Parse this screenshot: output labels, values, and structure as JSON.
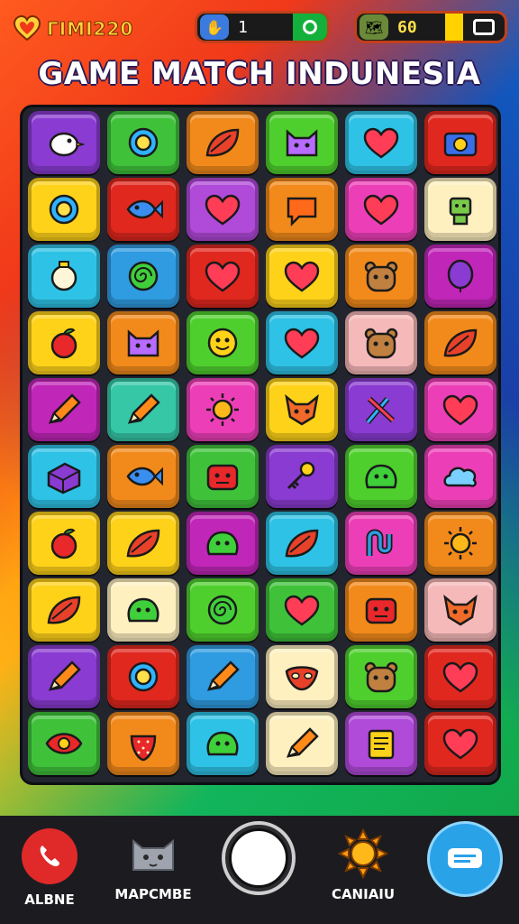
{
  "header": {
    "brand_text": "ΓΙΜΙ220",
    "brand_icon": "heart-icon",
    "left_counter": "1",
    "right_counter": "60",
    "title": "GAME MATCH INDUNESIA"
  },
  "colors": {
    "red": "#e0281f",
    "green": "#3fc23a",
    "orange": "#f28a1b",
    "purple": "#8a3bd1",
    "cyan": "#2ec2e6",
    "yellow": "#ffd21a",
    "pink": "#ec3fb7",
    "blue": "#2f9be0",
    "magenta": "#c026b8",
    "lime": "#4fcf2e",
    "cream": "#fff0c0",
    "teal": "#36c7a7",
    "peach": "#f6b9b9",
    "violet": "#b04ad8"
  },
  "board": {
    "rows": [
      [
        {
          "color": "purple",
          "icon": "bird-icon"
        },
        {
          "color": "green",
          "icon": "ring-icon"
        },
        {
          "color": "orange",
          "icon": "leaf-icon"
        },
        {
          "color": "lime",
          "icon": "cat-icon"
        },
        {
          "color": "cyan",
          "icon": "heart-icon"
        },
        {
          "color": "red",
          "icon": "camera-icon"
        }
      ],
      [
        {
          "color": "yellow",
          "icon": "ring-icon"
        },
        {
          "color": "red",
          "icon": "fish-icon"
        },
        {
          "color": "violet",
          "icon": "heart-icon"
        },
        {
          "color": "orange",
          "icon": "bubble-icon"
        },
        {
          "color": "pink",
          "icon": "heart-icon"
        },
        {
          "color": "cream",
          "icon": "robot-icon"
        }
      ],
      [
        {
          "color": "cyan",
          "icon": "pot-icon"
        },
        {
          "color": "blue",
          "icon": "spiral-icon"
        },
        {
          "color": "red",
          "icon": "heart-icon"
        },
        {
          "color": "yellow",
          "icon": "heart-icon"
        },
        {
          "color": "orange",
          "icon": "bear-icon"
        },
        {
          "color": "magenta",
          "icon": "balloon-icon"
        }
      ],
      [
        {
          "color": "yellow",
          "icon": "apple-icon"
        },
        {
          "color": "orange",
          "icon": "cat-icon"
        },
        {
          "color": "lime",
          "icon": "face-icon"
        },
        {
          "color": "cyan",
          "icon": "heart-icon"
        },
        {
          "color": "peach",
          "icon": "bear-icon"
        },
        {
          "color": "orange",
          "icon": "leaf-icon"
        }
      ],
      [
        {
          "color": "magenta",
          "icon": "pencil-icon"
        },
        {
          "color": "teal",
          "icon": "pencil-icon"
        },
        {
          "color": "pink",
          "icon": "sun-icon"
        },
        {
          "color": "yellow",
          "icon": "fox-icon"
        },
        {
          "color": "purple",
          "icon": "brush-icon"
        },
        {
          "color": "pink",
          "icon": "heart-icon"
        }
      ],
      [
        {
          "color": "cyan",
          "icon": "cube-icon"
        },
        {
          "color": "orange",
          "icon": "fish-icon"
        },
        {
          "color": "green",
          "icon": "monster-icon"
        },
        {
          "color": "purple",
          "icon": "key-icon"
        },
        {
          "color": "lime",
          "icon": "blob-icon"
        },
        {
          "color": "pink",
          "icon": "cloud-icon"
        }
      ],
      [
        {
          "color": "yellow",
          "icon": "apple-icon"
        },
        {
          "color": "yellow",
          "icon": "leaf-icon"
        },
        {
          "color": "magenta",
          "icon": "blob-icon"
        },
        {
          "color": "cyan",
          "icon": "leaf-icon"
        },
        {
          "color": "pink",
          "icon": "knot-icon"
        },
        {
          "color": "orange",
          "icon": "sun-icon"
        }
      ],
      [
        {
          "color": "yellow",
          "icon": "leaf-icon"
        },
        {
          "color": "cream",
          "icon": "blob-icon"
        },
        {
          "color": "lime",
          "icon": "spiral-icon"
        },
        {
          "color": "green",
          "icon": "heart-icon"
        },
        {
          "color": "orange",
          "icon": "monster-icon"
        },
        {
          "color": "peach",
          "icon": "fox-icon"
        }
      ],
      [
        {
          "color": "purple",
          "icon": "pencil-icon"
        },
        {
          "color": "red",
          "icon": "ring-icon"
        },
        {
          "color": "blue",
          "icon": "pencil-icon"
        },
        {
          "color": "cream",
          "icon": "mask-icon"
        },
        {
          "color": "lime",
          "icon": "bear-icon"
        },
        {
          "color": "red",
          "icon": "heart-icon"
        }
      ],
      [
        {
          "color": "green",
          "icon": "eye-icon"
        },
        {
          "color": "orange",
          "icon": "strawberry-icon"
        },
        {
          "color": "cyan",
          "icon": "blob-icon"
        },
        {
          "color": "cream",
          "icon": "pencil-icon"
        },
        {
          "color": "violet",
          "icon": "scroll-icon"
        },
        {
          "color": "red",
          "icon": "heart-icon"
        }
      ]
    ]
  },
  "bottom_nav": {
    "alone_label": "ALBNE",
    "mapcmbe_label": "MAPCMBE",
    "canlau_label": "CANIAIU"
  }
}
